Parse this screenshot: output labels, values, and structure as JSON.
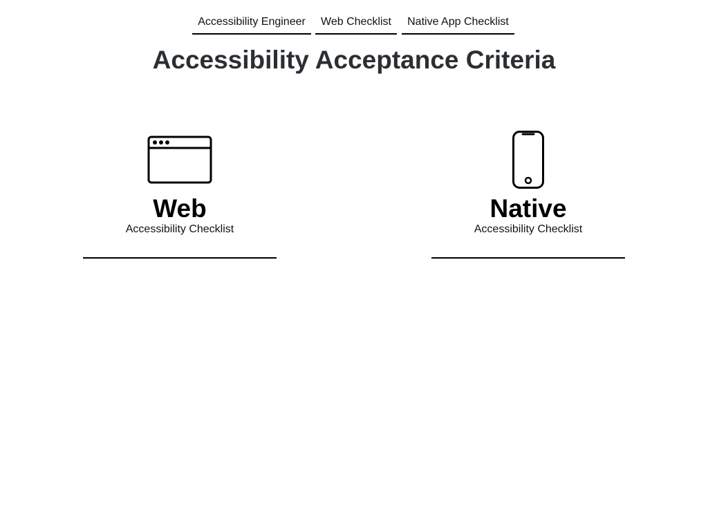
{
  "nav": {
    "items": [
      {
        "label": "Accessibility Engineer"
      },
      {
        "label": "Web Checklist"
      },
      {
        "label": "Native App Checklist"
      }
    ]
  },
  "page": {
    "title": "Accessibility Acceptance Criteria"
  },
  "cards": [
    {
      "icon": "browser-window-icon",
      "title": "Web",
      "subtitle": "Accessibility Checklist"
    },
    {
      "icon": "smartphone-icon",
      "title": "Native",
      "subtitle": "Accessibility Checklist"
    }
  ],
  "colors": {
    "title_text": "#2b2f33",
    "text": "#000000",
    "background": "#ffffff"
  }
}
